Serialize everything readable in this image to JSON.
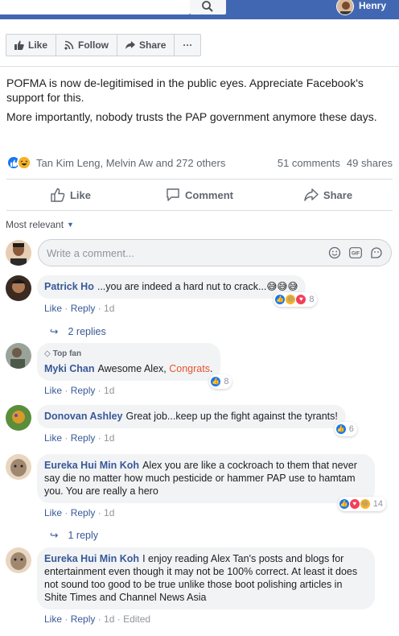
{
  "topbar": {
    "user_name": "Henry"
  },
  "page_buttons": {
    "like": "Like",
    "follow": "Follow",
    "share": "Share",
    "more": "···"
  },
  "post": {
    "paragraphs": [
      "POFMA is now de-legitimised in the public eyes. Appreciate Facebook's support for this.",
      "More importantly, nobody trusts the PAP government anymore these days."
    ],
    "reactors": "Tan Kim Leng, Melvin Aw and 272 others",
    "comments_count": "51 comments",
    "shares_count": "49 shares"
  },
  "actions": {
    "like": "Like",
    "comment": "Comment",
    "share": "Share"
  },
  "sort_label": "Most relevant",
  "composer": {
    "placeholder": "Write a comment...",
    "gif": "GIF"
  },
  "comments": [
    {
      "author": "Patrick Ho",
      "text": "...you are indeed a hard nut to crack...😅😅😅",
      "like": "Like",
      "reply": "Reply",
      "time": "1d",
      "reaction_count": "8",
      "replies": "2 replies"
    },
    {
      "badge": "Top fan",
      "author": "Myki Chan",
      "text": "Awesome Alex, ",
      "highlight": "Congrats",
      "text_end": ".",
      "like": "Like",
      "reply": "Reply",
      "time": "1d",
      "reaction_count": "8"
    },
    {
      "author": "Donovan Ashley",
      "text": "Great job...keep up the fight against the tyrants!",
      "like": "Like",
      "reply": "Reply",
      "time": "1d",
      "reaction_count": "6"
    },
    {
      "author": "Eureka Hui Min Koh",
      "text": "Alex you are like a cockroach to them that never say die no matter how much pesticide or hammer PAP use to hamtam you. You are really a hero",
      "like": "Like",
      "reply": "Reply",
      "time": "1d",
      "reaction_count": "14",
      "replies": "1 reply"
    },
    {
      "author": "Eureka Hui Min Koh",
      "text": "I enjoy reading Alex Tan's posts and blogs for entertainment even though it may not be 100% correct. At least it does not sound too good to be true unlike those boot polishing articles in Shite Times and Channel News Asia",
      "like": "Like",
      "reply": "Reply",
      "time": "1d",
      "edited": "Edited"
    }
  ],
  "colors": {
    "fb_blue": "#4267b2",
    "link": "#385898",
    "like": "#1877f2",
    "love": "#f33e58",
    "haha": "#f7b125",
    "congrats": "#e8542e"
  }
}
